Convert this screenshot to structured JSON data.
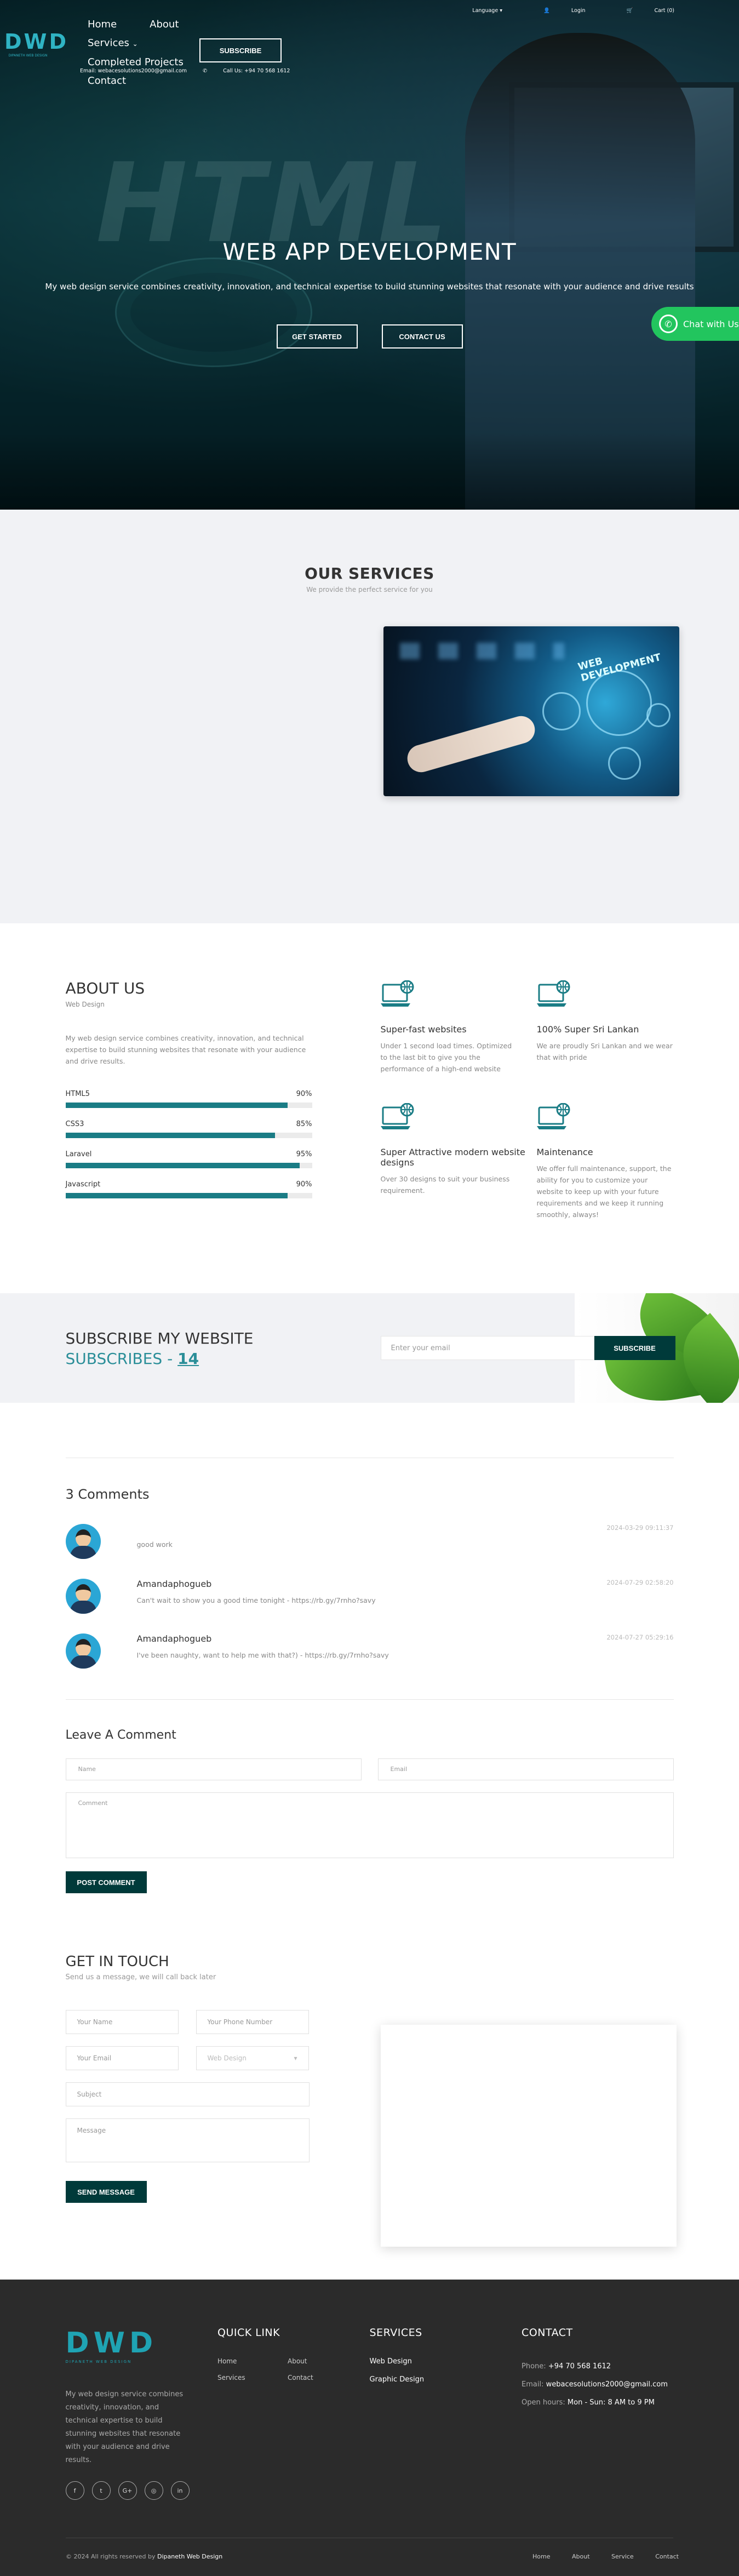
{
  "topbar": {
    "email": "Email: webacesolutions2000@gmail.com",
    "call": "Call Us: +94 70 568 1612",
    "language": "Language",
    "login": "Login",
    "cart": "Cart (0)"
  },
  "logo": {
    "letters": "DWD",
    "tagline": "DIPANETH WEB DESIGN"
  },
  "nav": {
    "home": "Home",
    "about": "About",
    "services": "Services",
    "completed": "Completed Projects",
    "contact": "Contact",
    "subscribe": "SUBSCRIBE"
  },
  "hero": {
    "bg_word": "HTML",
    "title": "WEB APP DEVELOPMENT",
    "subtitle": "My web design service combines creativity, innovation, and technical expertise to build stunning websites that resonate with your audience and drive results",
    "btn_start": "GET STARTED",
    "btn_contact": "CONTACT US"
  },
  "chat": {
    "label": "Chat with Us"
  },
  "services": {
    "title": "OUR SERVICES",
    "subtitle": "We provide the perfect service for you",
    "image_label": "WEB DEVELOPMENT"
  },
  "about": {
    "title": "ABOUT US",
    "subtitle": "Web Design",
    "desc": "My web design service combines creativity, innovation, and technical expertise to build stunning websites that resonate with your audience and drive results.",
    "skills": [
      {
        "name": "HTML5",
        "value": 90,
        "label": "90%"
      },
      {
        "name": "CSS3",
        "value": 85,
        "label": "85%"
      },
      {
        "name": "Laravel",
        "value": 95,
        "label": "95%"
      },
      {
        "name": "Javascript",
        "value": 90,
        "label": "90%"
      }
    ],
    "features": [
      {
        "title": "Super-fast websites",
        "text": "Under 1 second load times. Optimized to the last bit to give you the performance of a high-end website"
      },
      {
        "title": "100% Super Sri Lankan",
        "text": "We are proudly Sri Lankan and we wear that with pride"
      },
      {
        "title": "Super Attractive modern website designs",
        "text": "Over 30 designs to suit your business requirement."
      },
      {
        "title": "Maintenance",
        "text": "We offer full maintenance, support, the ability for you to customize your website to keep up with your future requirements and we keep it running smoothly, always!"
      }
    ],
    "accent": "#1a7c85"
  },
  "subscribe": {
    "title": "SUBSCRIBE MY WEBSITE",
    "count_label": "SUBSCRIBES - ",
    "count": "14",
    "placeholder": "Enter your email",
    "button": "SUBSCRIBE"
  },
  "comments": {
    "heading": "3 Comments",
    "items": [
      {
        "name": "",
        "text": "good work",
        "date": "2024-03-29 09:11:37"
      },
      {
        "name": "Amandaphogueb",
        "text": "Can't wait to show you a good time tonight - https://rb.gy/7rnho?savy",
        "date": "2024-07-29 02:58:20"
      },
      {
        "name": "Amandaphogueb",
        "text": "I've been naughty, want to help me with that?) - https://rb.gy/7rnho?savy",
        "date": "2024-07-27 05:29:16"
      }
    ]
  },
  "leave": {
    "heading": "Leave A Comment",
    "name_ph": "Name",
    "email_ph": "Email",
    "comment_ph": "Comment",
    "button": "POST COMMENT"
  },
  "contact": {
    "title": "GET IN TOUCH",
    "subtitle": "Send us a message, we will call back later",
    "name_ph": "Your Name",
    "phone_ph": "Your Phone Number",
    "email_ph": "Your Email",
    "service_selected": "Web Design",
    "subject_ph": "Subject",
    "message_ph": "Message",
    "button": "SEND MESSAGE"
  },
  "footer": {
    "desc": "My web design service combines creativity, innovation, and technical expertise to build stunning websites that resonate with your audience and drive results.",
    "social": [
      "f",
      "t",
      "G+",
      "◎",
      "in"
    ],
    "quick_title": "QUICK LINK",
    "quick_links": [
      "Home",
      "About",
      "Services",
      "Contact"
    ],
    "services_title": "SERVICES",
    "services": [
      "Web Design",
      "Graphic Design"
    ],
    "contact_title": "CONTACT",
    "phone_label": "Phone: ",
    "phone": "+94 70 568 1612",
    "email_label": "Email: ",
    "email": "webacesolutions2000@gmail.com",
    "hours_label": "Open hours: ",
    "hours": "Mon - Sun: 8 AM to 9 PM",
    "copyright": "2024 All rights reserved by ",
    "brand": "Dipaneth Web Design",
    "bottom_links": [
      "Home",
      "About",
      "Service",
      "Contact"
    ]
  }
}
